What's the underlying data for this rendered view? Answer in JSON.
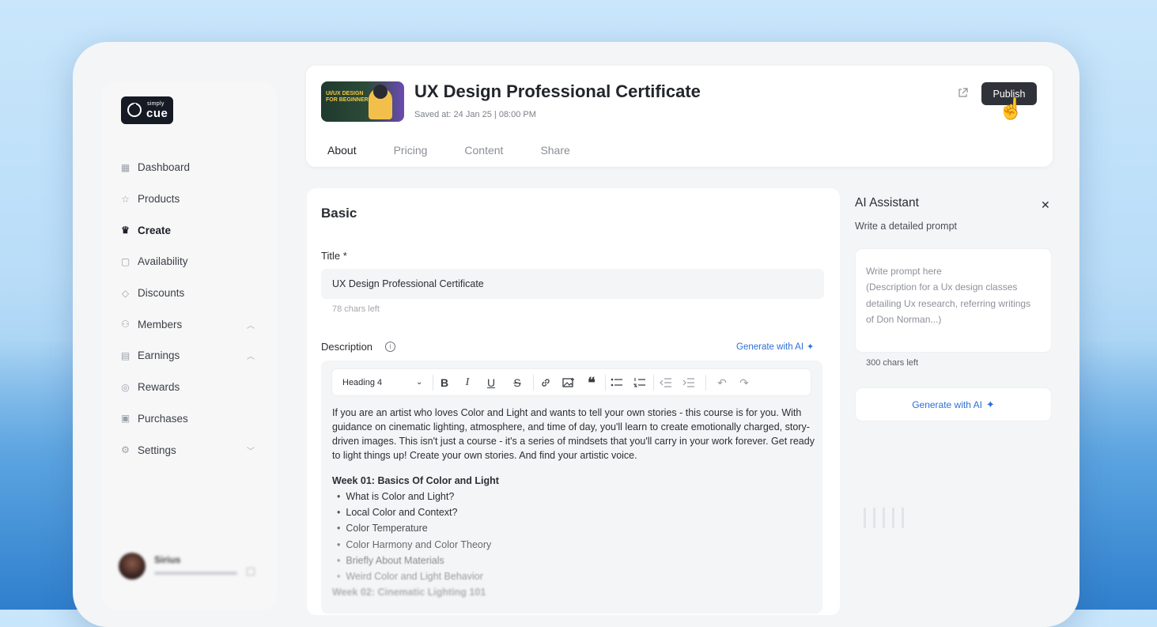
{
  "app": {
    "logo_small": "simply",
    "logo_main": "cue"
  },
  "sidebar": {
    "items": [
      {
        "label": "Dashboard",
        "icon": "dashboard-icon"
      },
      {
        "label": "Products",
        "icon": "products-icon"
      },
      {
        "label": "Create",
        "icon": "create-icon",
        "active": true
      },
      {
        "label": "Availability",
        "icon": "calendar-icon"
      },
      {
        "label": "Discounts",
        "icon": "tag-icon"
      },
      {
        "label": "Members",
        "icon": "members-icon",
        "chevron": "up"
      },
      {
        "label": "Earnings",
        "icon": "earnings-icon",
        "chevron": "up"
      },
      {
        "label": "Rewards",
        "icon": "rewards-icon"
      },
      {
        "label": "Purchases",
        "icon": "gift-icon"
      },
      {
        "label": "Settings",
        "icon": "gear-icon",
        "chevron": "down"
      }
    ],
    "user": {
      "name": "Sirius"
    }
  },
  "header": {
    "thumbnail_text": "UI/UX DESIGN\nFOR BEGINNERS",
    "title": "UX Design Professional Certificate",
    "saved": "Saved at: 24 Jan 25 | 08:00 PM",
    "publish_label": "Publish",
    "tabs": [
      "About",
      "Pricing",
      "Content",
      "Share"
    ],
    "active_tab": "About"
  },
  "basic": {
    "heading": "Basic",
    "title_label": "Title *",
    "title_value": "UX Design Professional Certificate",
    "title_chars_left": "78 chars left",
    "description_label": "Description",
    "generate_label": "Generate with AI"
  },
  "editor": {
    "heading_select": "Heading 4",
    "intro": "If you are an artist who loves Color and Light and wants to tell your own stories - this course is for you. With guidance on cinematic lighting, atmosphere, and time of day, you'll learn to create emotionally charged, story-driven images. This isn't just a course - it's a series of mindsets that you'll carry in your work forever. Get ready to light things up! Create your own stories. And find your artistic voice.",
    "week1_title": "Week 01: Basics Of Color and Light",
    "week1_items": [
      "What is Color and Light?",
      "Local Color and Context?",
      "Color Temperature",
      "Color Harmony and Color Theory",
      "Briefly About Materials",
      "Weird Color and Light Behavior"
    ],
    "week2_title": "Week 02: Cinematic Lighting 101"
  },
  "ai_assistant": {
    "title": "AI Assistant",
    "subtitle": "Write a detailed prompt",
    "placeholder": "Write prompt here\n(Description for a Ux design classes detailing Ux research, referring writings of Don Norman...)",
    "chars_left": "300 chars left",
    "generate_label": "Generate with AI"
  },
  "colors": {
    "accent": "#2f6fd6",
    "publish_bg": "#2f3239",
    "logo_bg": "#151a24"
  }
}
